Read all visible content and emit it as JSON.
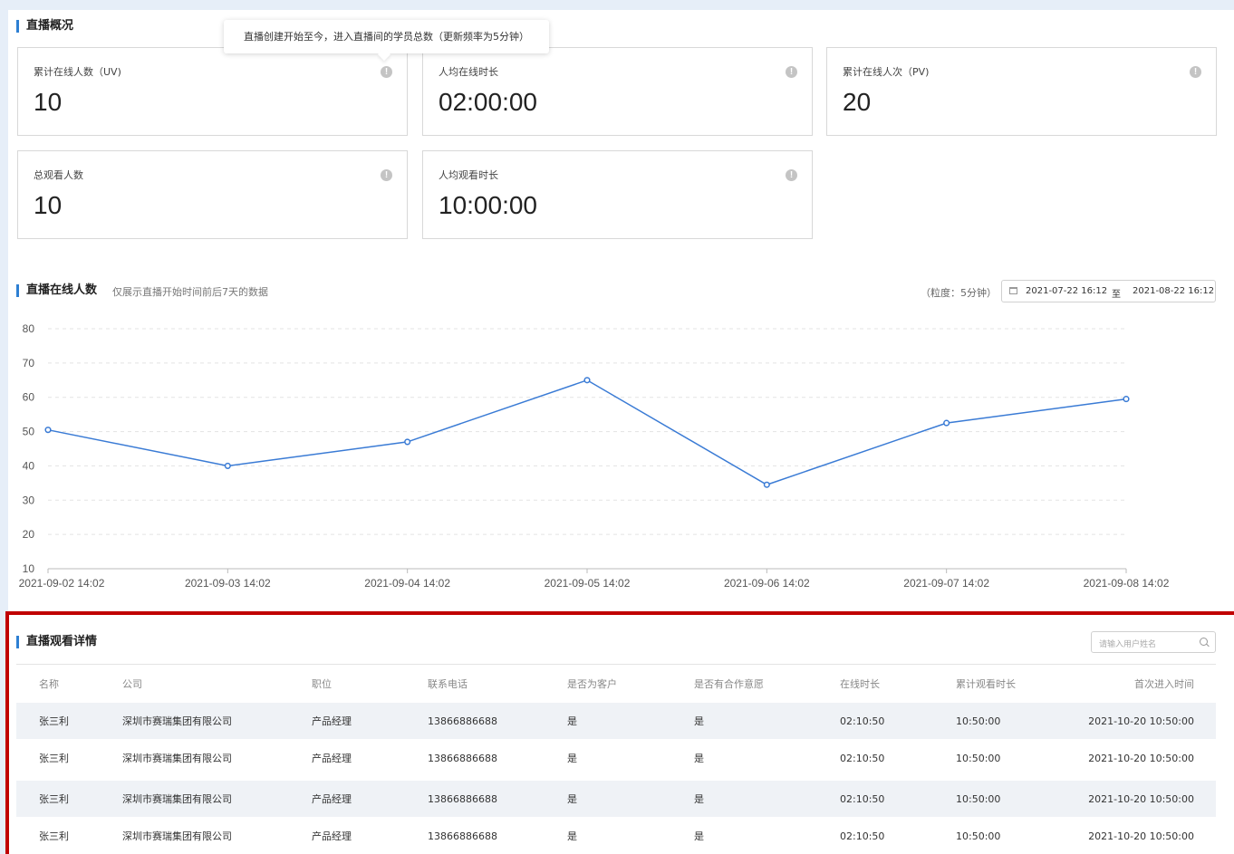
{
  "overview": {
    "title": "直播概况",
    "tooltip": "直播创建开始至今，进入直播间的学员总数（更新频率为5分钟）",
    "cards": [
      {
        "label": "累计在线人数（UV)",
        "value": "10"
      },
      {
        "label": "人均在线时长",
        "value": "02:00:00"
      },
      {
        "label": "累计在线人次（PV)",
        "value": "20"
      },
      {
        "label": "总观看人数",
        "value": "10"
      },
      {
        "label": "人均观看时长",
        "value": "10:00:00"
      }
    ]
  },
  "online_chart": {
    "title": "直播在线人数",
    "subtitle": "仅展示直播开始时间前后7天的数据",
    "granularity": "（粒度：5分钟）",
    "range_start": "2021-07-22 16:12",
    "range_sep": "至",
    "range_end": "2021-08-22 16:12"
  },
  "chart_data": {
    "type": "line",
    "title": "",
    "xlabel": "",
    "ylabel": "",
    "ylim": [
      10,
      80
    ],
    "yticks": [
      "10",
      "20",
      "30",
      "40",
      "50",
      "60",
      "70",
      "80"
    ],
    "grid": true,
    "categories": [
      "2021-09-02 14:02",
      "2021-09-03 14:02",
      "2021-09-04 14:02",
      "2021-09-05  14:02",
      "2021-09-06  14:02",
      "2021-09-07  14:02",
      "2021-09-08  14:02"
    ],
    "values": [
      50.5,
      40,
      47,
      65,
      34.5,
      52.5,
      59.5
    ],
    "color": "#3a7bd5"
  },
  "detail": {
    "title": "直播观看详情",
    "search_placeholder": "请输入用户姓名",
    "columns": [
      "名称",
      "公司",
      "职位",
      "联系电话",
      "是否为客户",
      "是否有合作意愿",
      "在线时长",
      "累计观看时长",
      "首次进入时间"
    ],
    "rows": [
      [
        "张三利",
        "深圳市赛瑞集团有限公司",
        "产品经理",
        "13866886688",
        "是",
        "是",
        "02:10:50",
        "10:50:00",
        "2021-10-20 10:50:00"
      ],
      [
        "张三利",
        "深圳市赛瑞集团有限公司",
        "产品经理",
        "13866886688",
        "是",
        "是",
        "02:10:50",
        "10:50:00",
        "2021-10-20 10:50:00"
      ],
      [
        "张三利",
        "深圳市赛瑞集团有限公司",
        "产品经理",
        "13866886688",
        "是",
        "是",
        "02:10:50",
        "10:50:00",
        "2021-10-20 10:50:00"
      ],
      [
        "张三利",
        "深圳市赛瑞集团有限公司",
        "产品经理",
        "13866886688",
        "是",
        "是",
        "02:10:50",
        "10:50:00",
        "2021-10-20 10:50:00"
      ]
    ]
  },
  "colors": {
    "accent": "#2d7fd3",
    "highlight_border": "#c00000",
    "row_stripe": "#eff2f6"
  }
}
